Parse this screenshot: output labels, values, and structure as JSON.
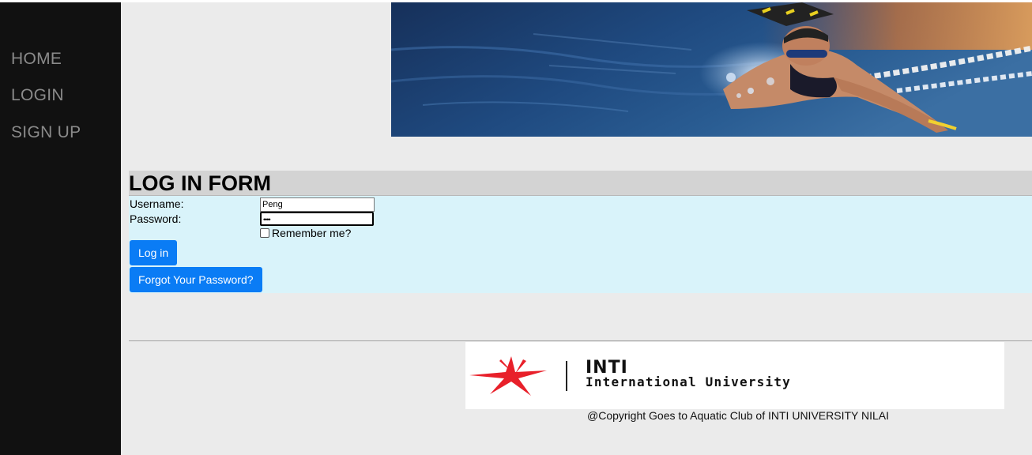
{
  "nav": {
    "home": "HOME",
    "login": "LOGIN",
    "signup": "SIGN UP"
  },
  "form": {
    "title": "LOG IN FORM",
    "username_label": "Username:",
    "username_value": "Peng",
    "password_label": "Password:",
    "password_masked": "••••",
    "remember_label": "Remember me?",
    "remember_checked": false,
    "login_button": "Log in",
    "forgot_button": "Forgot Your Password?"
  },
  "footer": {
    "logo_name": "INTI",
    "logo_subtitle": "International University",
    "copyright": "@Copyright Goes to Aquatic Club of INTI UNIVERSITY NILAI"
  },
  "colors": {
    "sidebar_bg": "#111111",
    "nav_text": "#8a8a8a",
    "button_blue": "#0a7cf5",
    "form_bg": "#d9f3fa",
    "logo_red": "#e8202a"
  },
  "icons": {
    "banner": "swimmer-banner-image",
    "logo": "inti-star-logo-icon"
  }
}
